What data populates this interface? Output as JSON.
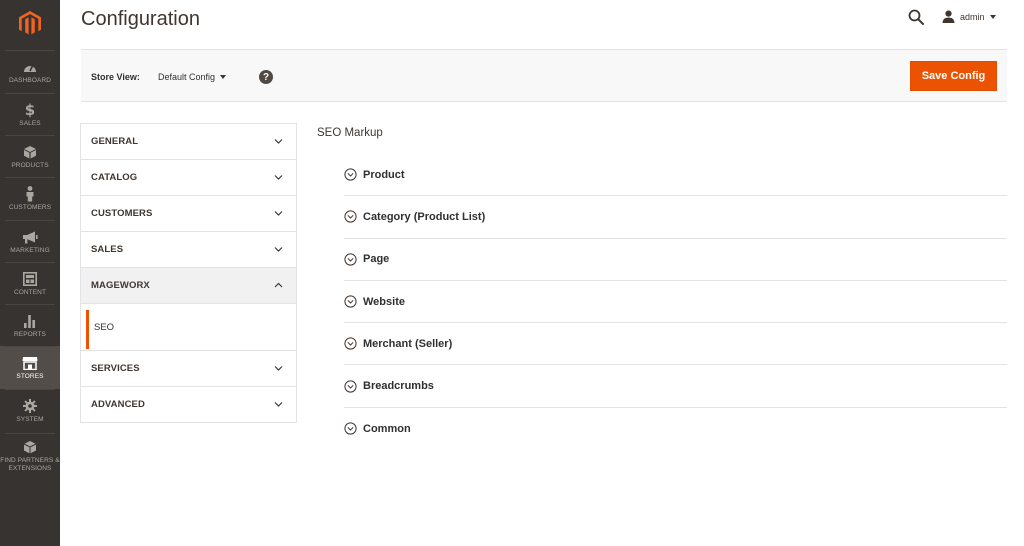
{
  "nav": {
    "items": [
      {
        "label": "DASHBOARD",
        "icon": "speedometer-icon"
      },
      {
        "label": "SALES",
        "icon": "dollar-icon"
      },
      {
        "label": "PRODUCTS",
        "icon": "cube-icon"
      },
      {
        "label": "CUSTOMERS",
        "icon": "person-icon"
      },
      {
        "label": "MARKETING",
        "icon": "megaphone-icon"
      },
      {
        "label": "CONTENT",
        "icon": "layout-icon"
      },
      {
        "label": "REPORTS",
        "icon": "bar-chart-icon"
      },
      {
        "label": "STORES",
        "icon": "storefront-icon"
      },
      {
        "label": "SYSTEM",
        "icon": "gear-icon"
      },
      {
        "label": "FIND PARTNERS & EXTENSIONS",
        "icon": "box-icon"
      }
    ],
    "active_index": 7,
    "accent_color": "#eb5202",
    "bg_color": "#373330"
  },
  "header": {
    "title": "Configuration",
    "user_name": "admin"
  },
  "store_bar": {
    "label": "Store View:",
    "selected": "Default Config",
    "save_label": "Save Config",
    "save_color": "#eb5202"
  },
  "tabs": [
    {
      "label": "GENERAL",
      "expanded": false
    },
    {
      "label": "CATALOG",
      "expanded": false
    },
    {
      "label": "CUSTOMERS",
      "expanded": false
    },
    {
      "label": "SALES",
      "expanded": false
    },
    {
      "label": "MAGEWORX",
      "expanded": true,
      "children": [
        "SEO"
      ]
    },
    {
      "label": "SERVICES",
      "expanded": false
    },
    {
      "label": "ADVANCED",
      "expanded": false
    }
  ],
  "section": {
    "title": "SEO Markup",
    "groups": [
      "Product",
      "Category (Product List)",
      "Page",
      "Website",
      "Merchant (Seller)",
      "Breadcrumbs",
      "Common"
    ]
  }
}
